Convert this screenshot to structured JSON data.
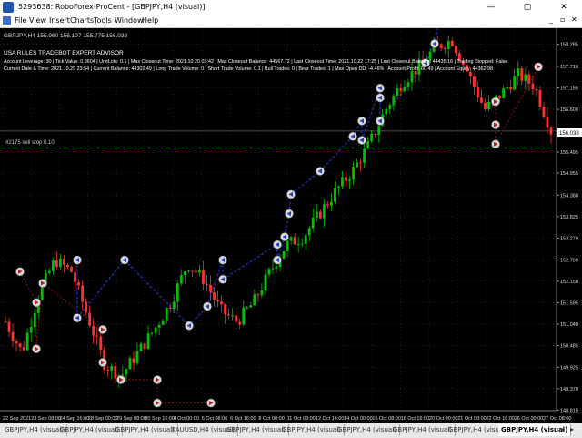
{
  "window": {
    "title": "5293638: RoboForex-ProCent - [GBPJPY,H4 (visual)]",
    "minimize": "—",
    "restore": "▢",
    "close": "✕"
  },
  "menu": {
    "items": [
      "File",
      "View",
      "Insert",
      "Charts",
      "Tools",
      "Window",
      "Help"
    ],
    "mdi_min": "_",
    "mdi_restore": "▫",
    "mdi_close": "✕"
  },
  "chart": {
    "header": "GBPJPY,H4  155.960 156.107 155.775 156.038",
    "ea_name": "USA RULES TRADEBOT EXPERT ADVISOR",
    "info_line1": "Account Leverage: 30 | Tick Value: 0.8604 | UnitLots: 0.1 | Max Closeout Time: 2021.10.20 03:42 | Max Closeout Balance: 44567.72 | Last Closeout Time: 2021.10.22 17:25 | Last Closeout Balance: 44435.16 | Trading Stopped: False",
    "info_line2": "Current Date & Time: 2021.10.29 23:54 | Current Balance: 44302.49 | Long Trade Volume: 0 | Short Trade Volume: 0.1 | Bull Trades: 0 | Bear Trades: 1 | Max Open DD: -4.46% | Account Profit: 60.49 | Account Equity: 44362.98",
    "stop_label": "#2175 sell stop 0.10",
    "price_tag": "156.038",
    "colors": {
      "bull": "#00c000",
      "bear": "#ff3030",
      "line": "#1c2a9a",
      "stop": "#00a000",
      "bg": "#000000",
      "grid": "#3a3a3a"
    }
  },
  "chart_data": {
    "type": "candlestick",
    "symbol": "GBPJPY",
    "timeframe": "H4",
    "ylim": [
      148.8,
      158.7
    ],
    "y_ticks": [
      158.285,
      157.71,
      157.155,
      156.6,
      156.038,
      155.495,
      154.955,
      154.38,
      153.825,
      153.27,
      152.7,
      152.15,
      151.595,
      151.04,
      150.485,
      149.925,
      149.37,
      148.815
    ],
    "y_tick_labels": [
      "158.285",
      "157.710",
      "157.155",
      "156.600",
      "156.038",
      "155.495",
      "154.955",
      "154.380",
      "153.825",
      "153.270",
      "152.700",
      "152.150",
      "151.595",
      "151.040",
      "150.485",
      "149.925",
      "149.370",
      "148.815"
    ],
    "x_labels": [
      "22 Sep 2021",
      "23 Sep 08:00",
      "24 Sep 16:00",
      "28 Sep 00:00",
      "29 Sep 08:00",
      "30 Sep 16:00",
      "4 Oct 00:00",
      "5 Oct 08:00",
      "6 Oct 16:00",
      "8 Oct 00:00",
      "11 Oct 08:00",
      "12 Oct 16:00",
      "14 Oct 00:00",
      "15 Oct 08:00",
      "18 Oct 16:00",
      "20 Oct 00:00",
      "21 Oct 08:00",
      "22 Oct 16:00",
      "26 Oct 00:00",
      "27 Oct 08:00"
    ],
    "current_price": 156.038,
    "sell_stop_level": 155.6,
    "path": [
      151.1,
      150.3,
      151.8,
      152.7,
      152.4,
      151.2,
      150.0,
      149.7,
      150.3,
      150.9,
      151.6,
      152.6,
      152.2,
      151.4,
      151.1,
      151.6,
      152.4,
      153.1,
      153.3,
      153.9,
      154.5,
      155.0,
      155.7,
      156.6,
      157.3,
      157.7,
      158.2,
      158.4,
      157.5,
      156.6,
      157.0,
      157.5,
      157.2,
      156.038
    ],
    "trade_markers": [
      {
        "x": 22,
        "price": 152.4,
        "type": "sell"
      },
      {
        "x": 40,
        "price": 151.6,
        "type": "sell"
      },
      {
        "x": 47,
        "price": 152.1,
        "type": "sell"
      },
      {
        "x": 40,
        "price": 150.4,
        "type": "sell"
      },
      {
        "x": 85,
        "price": 152.7,
        "type": "buy"
      },
      {
        "x": 85,
        "price": 151.2,
        "type": "buy"
      },
      {
        "x": 113,
        "price": 150.9,
        "type": "sell"
      },
      {
        "x": 113,
        "price": 150.05,
        "type": "sell"
      },
      {
        "x": 133,
        "price": 149.6,
        "type": "sell"
      },
      {
        "x": 137,
        "price": 152.7,
        "type": "buy"
      },
      {
        "x": 173,
        "price": 149.6,
        "type": "sell"
      },
      {
        "x": 173,
        "price": 149.0,
        "type": "sell"
      },
      {
        "x": 208,
        "price": 151.0,
        "type": "buy"
      },
      {
        "x": 228,
        "price": 151.5,
        "type": "buy"
      },
      {
        "x": 232,
        "price": 149.0,
        "type": "sell"
      },
      {
        "x": 245,
        "price": 152.7,
        "type": "buy"
      },
      {
        "x": 245,
        "price": 152.2,
        "type": "buy"
      },
      {
        "x": 305,
        "price": 153.1,
        "type": "buy"
      },
      {
        "x": 305,
        "price": 152.7,
        "type": "buy"
      },
      {
        "x": 313,
        "price": 153.3,
        "type": "buy"
      },
      {
        "x": 318,
        "price": 153.9,
        "type": "buy"
      },
      {
        "x": 320,
        "price": 154.4,
        "type": "buy"
      },
      {
        "x": 352,
        "price": 155.0,
        "type": "buy"
      },
      {
        "x": 388,
        "price": 155.9,
        "type": "buy"
      },
      {
        "x": 398,
        "price": 156.3,
        "type": "buy"
      },
      {
        "x": 398,
        "price": 155.8,
        "type": "buy"
      },
      {
        "x": 418,
        "price": 157.15,
        "type": "buy"
      },
      {
        "x": 418,
        "price": 156.9,
        "type": "buy"
      },
      {
        "x": 418,
        "price": 156.3,
        "type": "buy"
      },
      {
        "x": 468,
        "price": 157.8,
        "type": "buy"
      },
      {
        "x": 478,
        "price": 158.3,
        "type": "buy"
      },
      {
        "x": 483,
        "price": 158.9,
        "type": "buy"
      },
      {
        "x": 545,
        "price": 156.8,
        "type": "sell"
      },
      {
        "x": 545,
        "price": 156.2,
        "type": "sell"
      },
      {
        "x": 545,
        "price": 155.7,
        "type": "sell"
      },
      {
        "x": 592,
        "price": 157.7,
        "type": "sell"
      }
    ]
  },
  "tabs": {
    "items": [
      "GBPJPY,H4 (visual)",
      "GBPJPY,H4 (visual)",
      "GBPJPY,H4 (visual)",
      "XAUUSD,H4 (visual)",
      "GBPJPY,H4 (visual)",
      "GBPJPY,H4 (visual)",
      "GBPJPY,H4 (visual)",
      "GBPJPY,H4 (visual)",
      "GBPJPY,H4 (visual)",
      "GBPJPY,H4 (visual)"
    ],
    "active_index": 9,
    "left_arrow": "◂",
    "right_arrow": "▸"
  }
}
